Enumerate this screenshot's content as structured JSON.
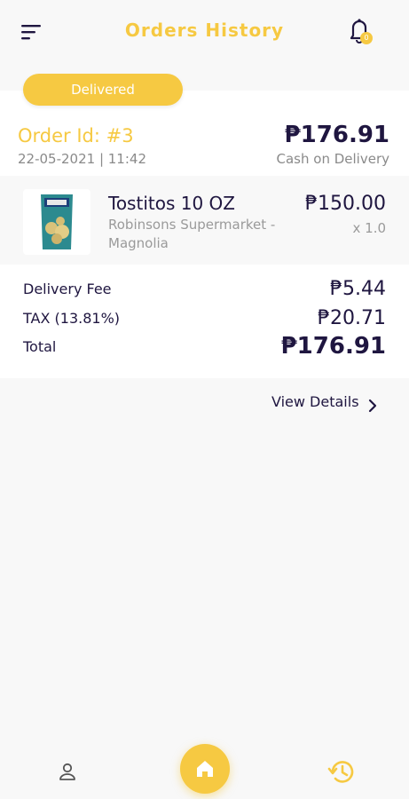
{
  "colors": {
    "accent": "#f6c942",
    "text_dark": "#1f1640",
    "text_muted": "#8a8a8a",
    "background": "#f8f8f8"
  },
  "header": {
    "title": "Orders History",
    "menu_icon": "menu-icon",
    "bell_icon": "bell-icon",
    "badge_count": "0"
  },
  "order": {
    "status": "Delivered",
    "id_label": "Order Id: #3",
    "date": "22-05-2021 | 11:42",
    "total": "₱176.91",
    "payment_method": "Cash on Delivery"
  },
  "item": {
    "name": "Tostitos 10 OZ",
    "store": "Robinsons Supermarket - Magnolia",
    "price": "₱150.00",
    "quantity": "x 1.0",
    "image_icon": "product-image"
  },
  "summary": {
    "delivery_fee_label": "Delivery Fee",
    "delivery_fee_value": "₱5.44",
    "tax_label": "TAX (13.81%)",
    "tax_value": "₱20.71",
    "total_label": "Total",
    "total_value": "₱176.91"
  },
  "view_details_label": "View Details",
  "bottom_nav": {
    "items": [
      "user-icon",
      "home-icon",
      "history-icon"
    ]
  }
}
